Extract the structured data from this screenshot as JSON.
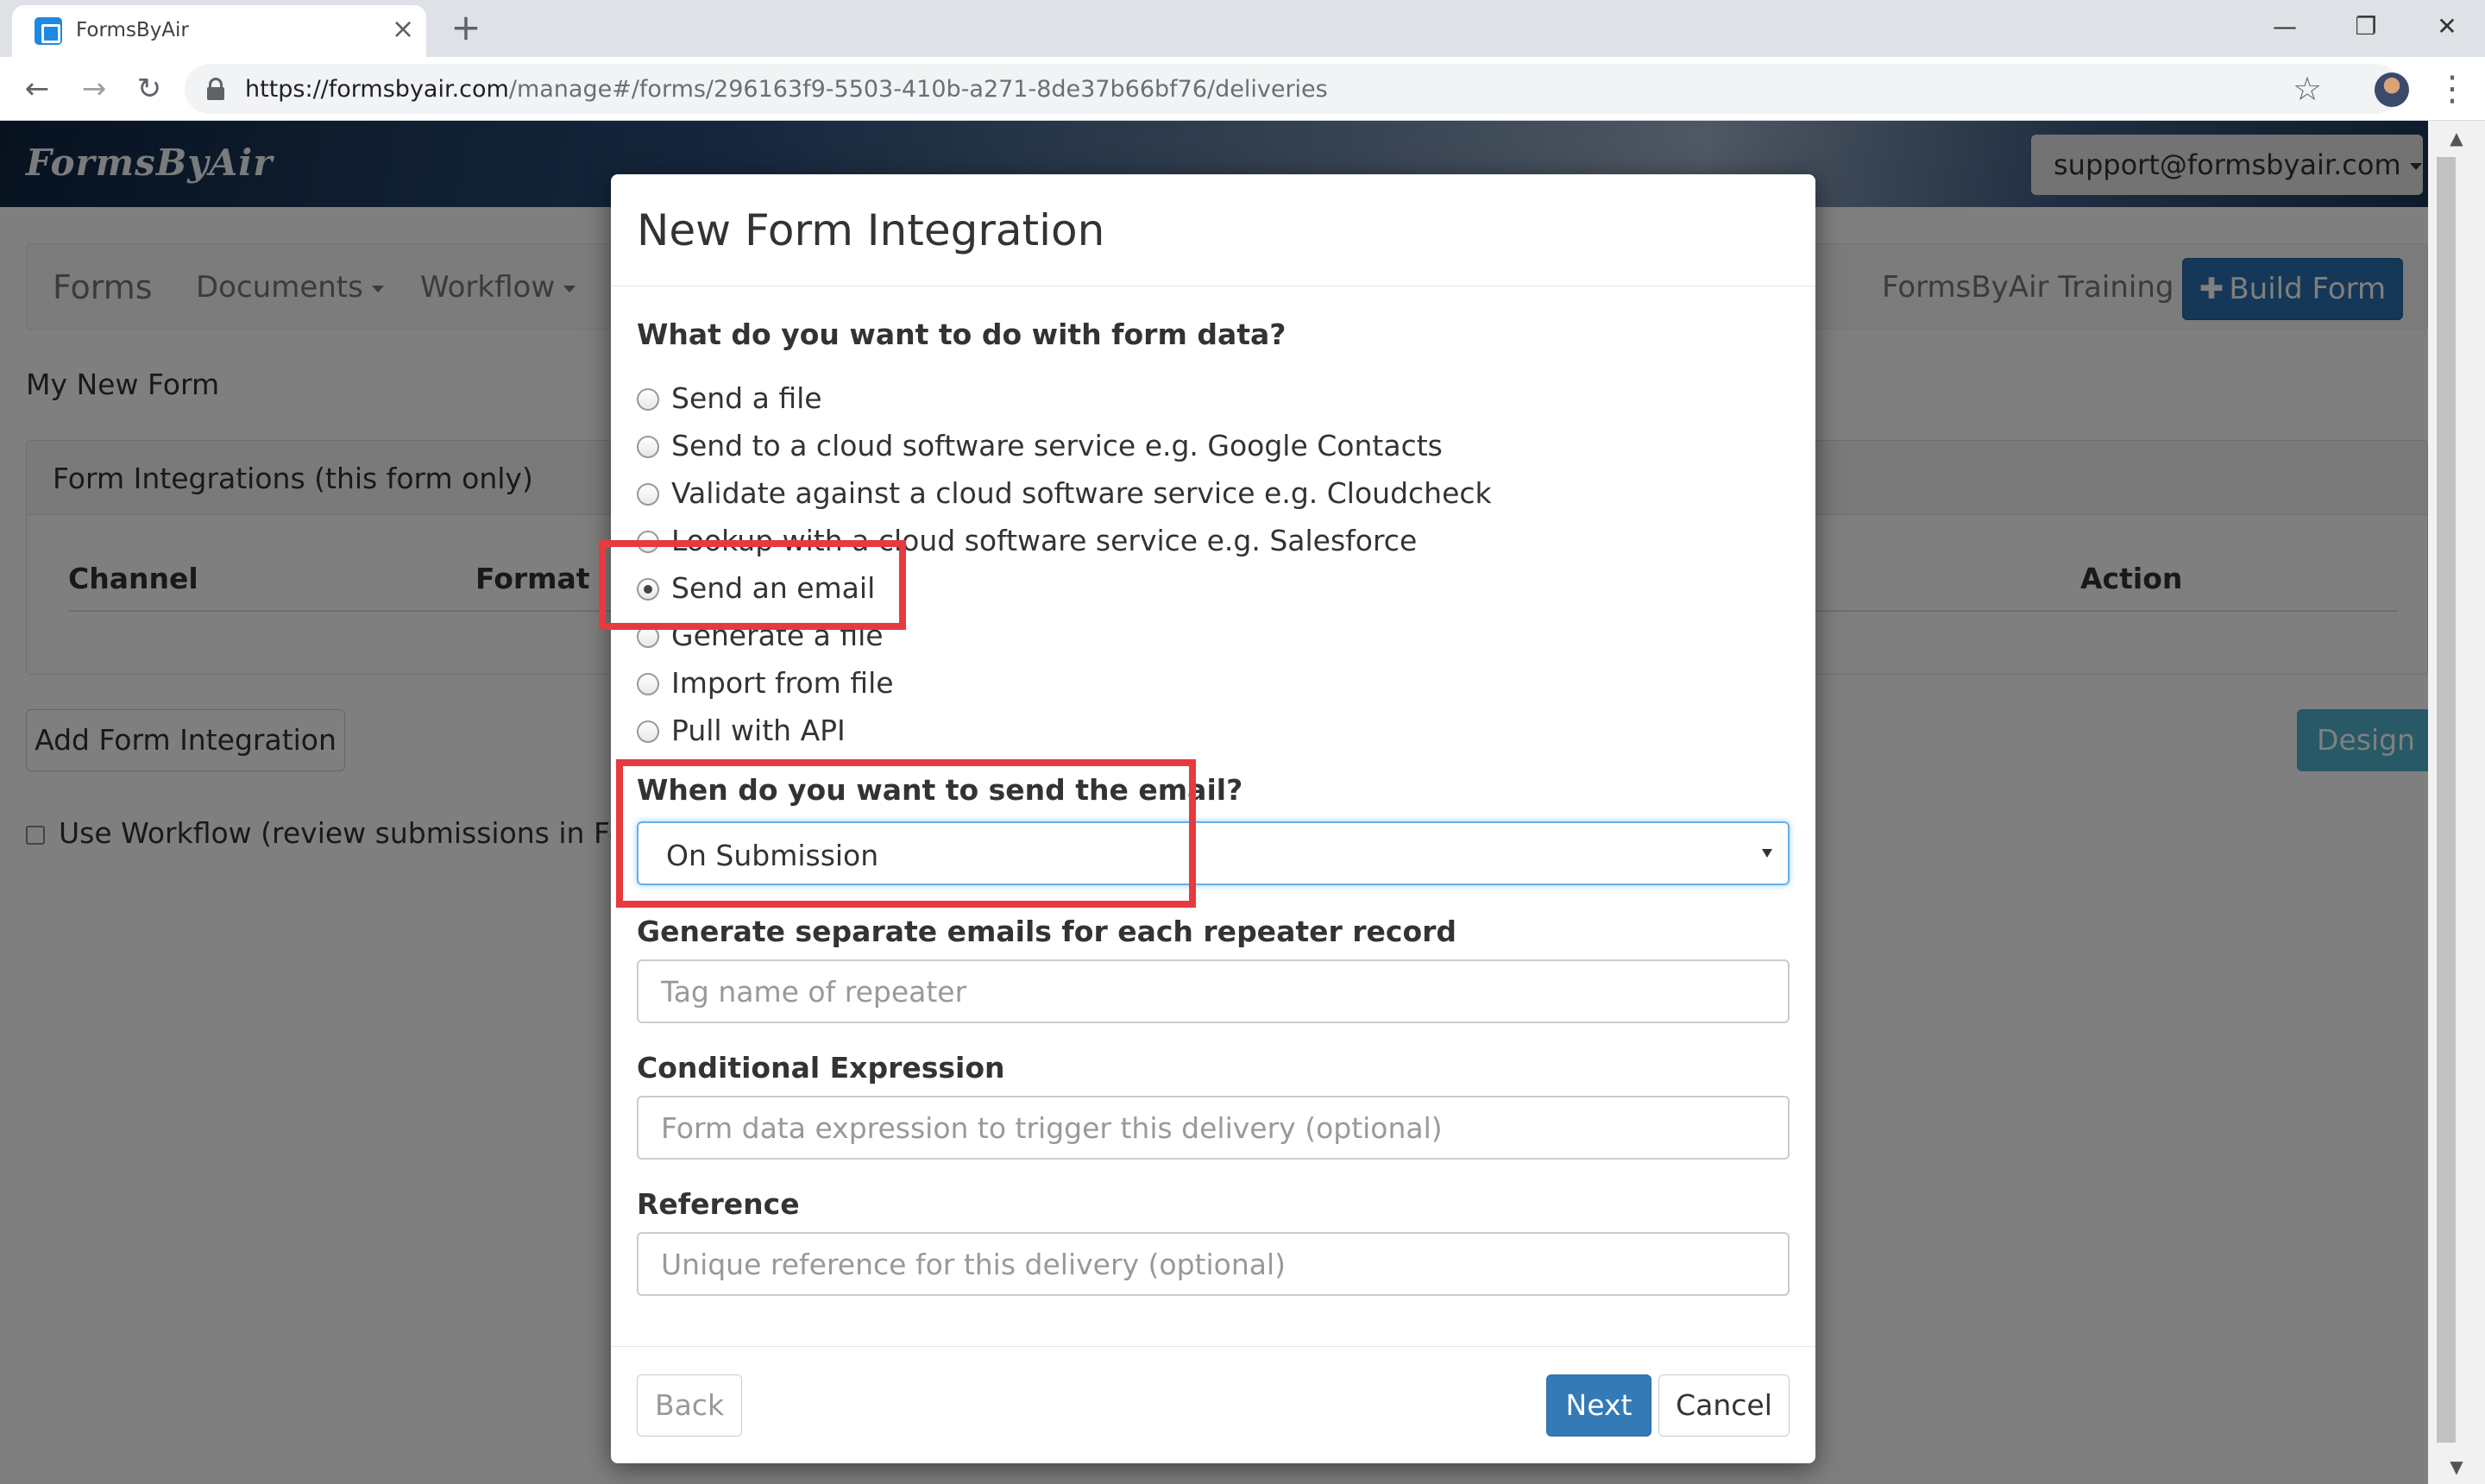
{
  "browser": {
    "tab_title": "FormsByAir",
    "url_host": "https://formsbyair.com",
    "url_path": "/manage#/forms/296163f9-5503-410b-a271-8de37b66bf76/deliveries"
  },
  "app": {
    "logo": "FormsByAir",
    "user_email": "support@formsbyair.com",
    "nav": {
      "forms": "Forms",
      "documents": "Documents",
      "workflow": "Workflow",
      "training": "FormsByAir Training",
      "build_form": "Build Form"
    },
    "form_name": "My New Form",
    "panel_title": "Form Integrations (this form only)",
    "columns": [
      "Channel",
      "Format",
      "Action"
    ],
    "add_integration": "Add Form Integration",
    "design": "Design",
    "use_workflow": "Use Workflow (review submissions in Form"
  },
  "modal": {
    "title": "New Form Integration",
    "question_1": "What do you want to do with form data?",
    "options": [
      {
        "label": "Send a file",
        "checked": false
      },
      {
        "label": "Send to a cloud software service e.g. Google Contacts",
        "checked": false
      },
      {
        "label": "Validate against a cloud software service e.g. Cloudcheck",
        "checked": false
      },
      {
        "label": "Lookup with a cloud software service e.g. Salesforce",
        "checked": false
      },
      {
        "label": "Send an email",
        "checked": true
      },
      {
        "label": "Generate a file",
        "checked": false
      },
      {
        "label": "Import from file",
        "checked": false
      },
      {
        "label": "Pull with API",
        "checked": false
      }
    ],
    "question_2": "When do you want to send the email?",
    "send_when_value": "On Submission",
    "repeater_label": "Generate separate emails for each repeater record",
    "repeater_placeholder": "Tag name of repeater",
    "conditional_label": "Conditional Expression",
    "conditional_placeholder": "Form data expression to trigger this delivery (optional)",
    "reference_label": "Reference",
    "reference_placeholder": "Unique reference for this delivery (optional)",
    "back": "Back",
    "next": "Next",
    "cancel": "Cancel"
  },
  "annotation_color": "#e63a3f"
}
